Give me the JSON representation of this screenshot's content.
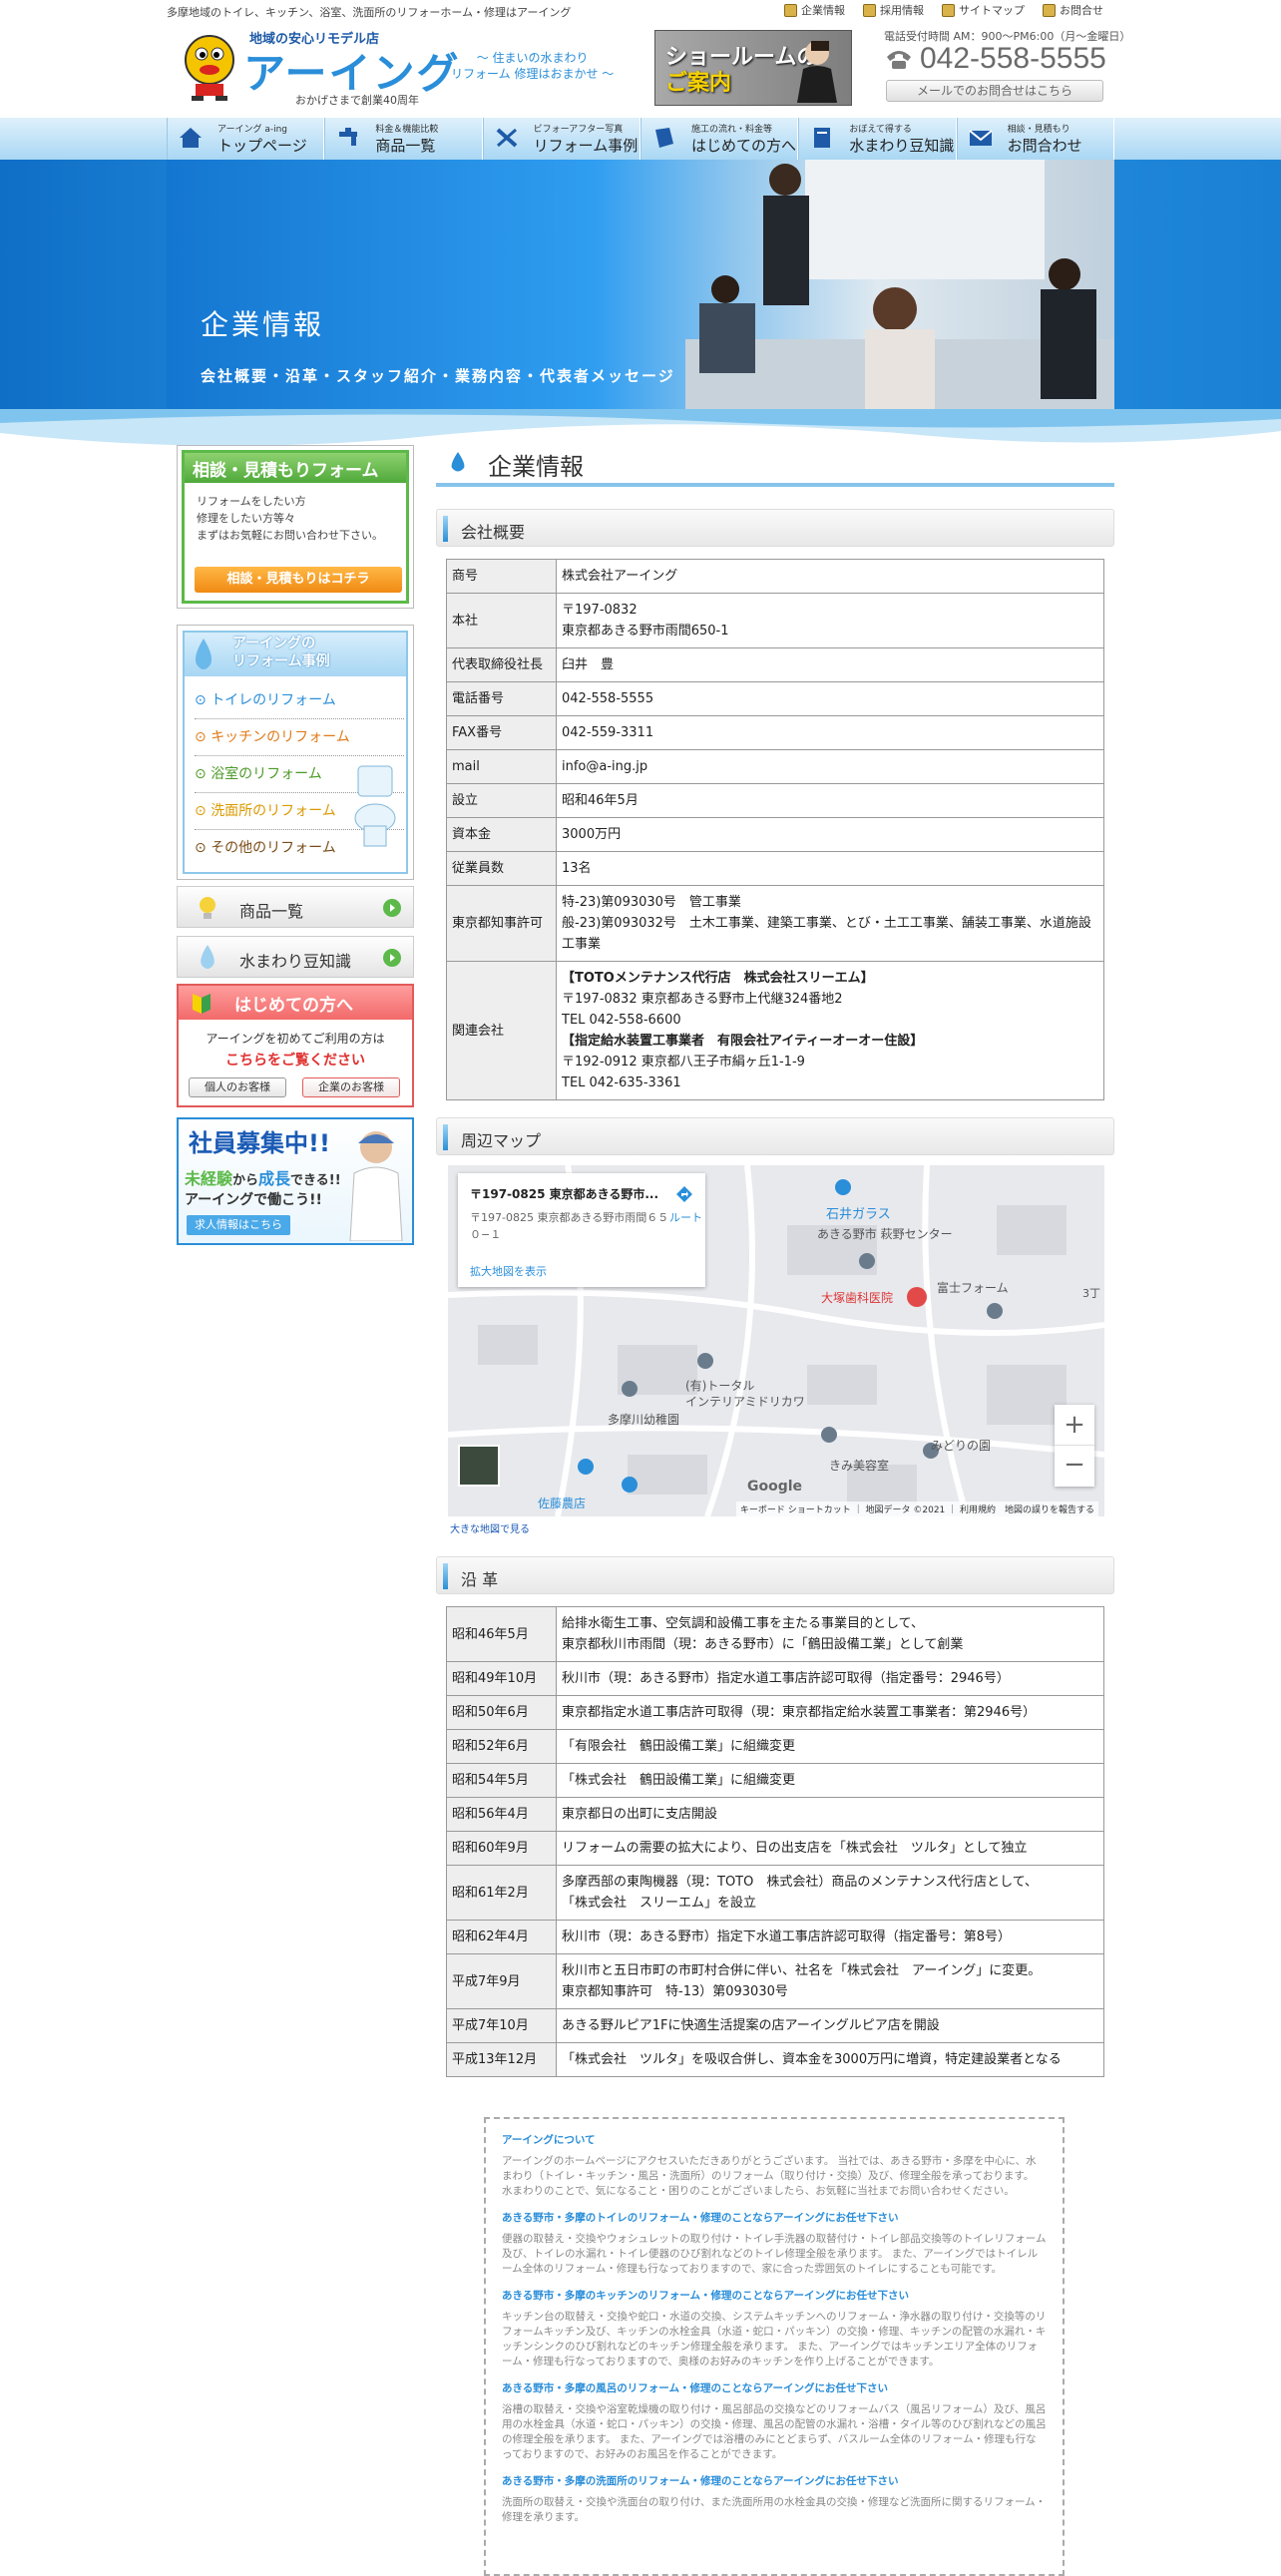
{
  "topbar": {
    "tagline": "多摩地域のトイレ、キッチン、浴室、洗面所のリフォーホーム・修理はアーイング",
    "links": [
      "企業情報",
      "採用情報",
      "サイトマップ",
      "お問合せ"
    ]
  },
  "header": {
    "logo_sub": "地域の安心リモデル店",
    "logo_main": "アーイング",
    "logo_since": "おかげさまで創業40周年",
    "catch_line1": "〜 住まいの水まわり",
    "catch_line2": "リフォーム 修理はおまかせ 〜",
    "showroom_line1": "ショールームの",
    "showroom_line2": "ご案内",
    "hours": "電話受付時間 AM：900〜PM6:00（月〜金曜日）",
    "phone": "042-558-5555",
    "mail_button": "メールでのお問合せはこちら"
  },
  "nav": [
    {
      "sub": "アーイング a-ing",
      "label": "トップページ"
    },
    {
      "sub": "料金＆機能比較",
      "label": "商品一覧"
    },
    {
      "sub": "ビフォーアフター写真",
      "label": "リフォーム事例"
    },
    {
      "sub": "施工の流れ・料金等",
      "label": "はじめての方へ"
    },
    {
      "sub": "おぼえて得する",
      "label": "水まわり豆知識"
    },
    {
      "sub": "相談・見積もり",
      "label": "お問合わせ"
    }
  ],
  "hero": {
    "title": "企業情報",
    "subtitle": "会社概要・沿革・スタッフ紹介・業務内容・代表者メッセージ"
  },
  "sidebar": {
    "consult": {
      "title": "相談・見積もりフォーム",
      "text1": "リフォームをしたい方",
      "text2": "修理をしたい方等々",
      "text3": "まずはお気軽にお問い合わせ下さい。",
      "button": "相談・見積もりはコチラ"
    },
    "cases": {
      "title1": "アーイングの",
      "title2": "リフォーム事例",
      "items": [
        "トイレのリフォーム",
        "キッチンのリフォーム",
        "浴室のリフォーム",
        "洗面所のリフォーム",
        "その他のリフォーム"
      ]
    },
    "products": "商品一覧",
    "water": "水まわり豆知識",
    "first": {
      "title": "はじめての方へ",
      "text": "アーイングを初めてご利用の方は",
      "link": "こちらをご覧ください",
      "btn_personal": "個人のお客様",
      "btn_company": "企業のお客様"
    },
    "recruit": {
      "title": "社員募集中!!",
      "line_a1": "未経験",
      "line_a2": "から",
      "line_a3": "成長",
      "line_a4": "できる!!",
      "line_b": "アーイングで働こう!!",
      "button": "求人情報はこちら"
    }
  },
  "content": {
    "page_title": "企業情報",
    "overview_title": "会社概要",
    "overview": [
      {
        "k": "商号",
        "v": [
          "株式会社アーイング"
        ]
      },
      {
        "k": "本社",
        "v": [
          "〒197-0832",
          "東京都あきる野市雨間650-1"
        ]
      },
      {
        "k": "代表取締役社長",
        "v": [
          "臼井　豊"
        ]
      },
      {
        "k": "電話番号",
        "v": [
          "042-558-5555"
        ]
      },
      {
        "k": "FAX番号",
        "v": [
          "042-559-3311"
        ]
      },
      {
        "k": "mail",
        "v": [
          "info@a-ing.jp"
        ]
      },
      {
        "k": "設立",
        "v": [
          "昭和46年5月"
        ]
      },
      {
        "k": "資本金",
        "v": [
          "3000万円"
        ]
      },
      {
        "k": "従業員数",
        "v": [
          "13名"
        ]
      },
      {
        "k": "東京都知事許可",
        "v": [
          "特-23)第093030号　管工事業",
          "般-23)第093032号　土木工事業、建築工事業、とび・土工工事業、舗装工事業、水道施設工事業"
        ]
      },
      {
        "k": "関連会社",
        "v": [
          "【TOTOメンテナンス代行店　株式会社スリーエム】",
          "〒197-0832 東京都あきる野市上代継324番地2",
          "TEL 042-558-6600",
          "【指定給水装置工事業者　有限会社アイティーオーオー住設】",
          "〒192-0912 東京都八王子市絹ヶ丘1-1-9",
          "TEL 042-635-3361"
        ]
      }
    ],
    "map_title": "周辺マップ",
    "map": {
      "card_title": "〒197-0825 東京都あきる野市...",
      "card_addr": "〒197-0825 東京都あきる野市雨間６５０−１",
      "route": "ルート",
      "enlarge": "拡大地図を表示",
      "labels": [
        "石井ガラス",
        "あきる野市 萩野センター",
        "大塚歯科医院",
        "富士フォーム",
        "(有)トータル",
        "インテリアミドリカワ",
        "多摩川幼稚園",
        "きみ美容室",
        "みどりの園",
        "佐藤農店",
        "3丁"
      ],
      "zoom_in": "+",
      "zoom_out": "−",
      "attribution": "キーボード ショートカット ｜ 地図データ ©2021 ｜ 利用規約　地図の誤りを報告する",
      "google": "Google",
      "bottom_link": "大きな地図で見る"
    },
    "history_title": "沿 革",
    "history": [
      {
        "k": "昭和46年5月",
        "v": [
          "給排水衛生工事、空気調和設備工事を主たる事業目的として、",
          "東京都秋川市雨間（現：あきる野市）に「鶴田設備工業」として創業"
        ]
      },
      {
        "k": "昭和49年10月",
        "v": [
          "秋川市（現：あきる野市）指定水道工事店許認可取得（指定番号：2946号）"
        ]
      },
      {
        "k": "昭和50年6月",
        "v": [
          "東京都指定水道工事店許可取得（現：東京都指定給水装置工事業者：第2946号）"
        ]
      },
      {
        "k": "昭和52年6月",
        "v": [
          "「有限会社　鶴田設備工業」に組織変更"
        ]
      },
      {
        "k": "昭和54年5月",
        "v": [
          "「株式会社　鶴田設備工業」に組織変更"
        ]
      },
      {
        "k": "昭和56年4月",
        "v": [
          "東京都日の出町に支店開設"
        ]
      },
      {
        "k": "昭和60年9月",
        "v": [
          "リフォームの需要の拡大により、日の出支店を「株式会社　ツルタ」として独立"
        ]
      },
      {
        "k": "昭和61年2月",
        "v": [
          "多摩西部の東陶機器（現：TOTO　株式会社）商品のメンテナンス代行店として、",
          "「株式会社　スリーエム」を設立"
        ]
      },
      {
        "k": "昭和62年4月",
        "v": [
          "秋川市（現：あきる野市）指定下水道工事店許認可取得（指定番号：第8号）"
        ]
      },
      {
        "k": "平成7年9月",
        "v": [
          "秋川市と五日市町の市町村合併に伴い、社名を「株式会社　アーイング」に変更。",
          "東京都知事許可　特-13）第093030号"
        ]
      },
      {
        "k": "平成7年10月",
        "v": [
          "あきる野ルピア1Fに快適生活提案の店アーイングルピア店を開設"
        ]
      },
      {
        "k": "平成13年12月",
        "v": [
          "「株式会社　ツルタ」を吸収合併し、資本金を3000万円に増資，特定建設業者となる"
        ]
      }
    ]
  },
  "seo": [
    {
      "title": "アーイングについて",
      "text": "アーイングのホームページにアクセスいただきありがとうございます。 当社では、あきる野市・多摩を中心に、水まわり（トイレ・キッチン・風呂・洗面所）のリフォーム（取り付け・交換）及び、修理全般を承っております。 水まわりのことで、気になること・困りのことがございましたら、お気軽に当社までお問い合わせください。"
    },
    {
      "title": "あきる野市・多摩のトイレのリフォーム・修理のことならアーイングにお任せ下さい",
      "text": "便器の取替え・交換やウォシュレットの取り付け・トイレ手洗器の取替付け・トイレ部品交換等のトイレリフォーム及び、トイレの水漏れ・トイレ便器のひび割れなどのトイレ修理全般を承ります。 また、アーイングではトイレルーム全体のリフォーム・修理も行なっておりますので、家に合った雰囲気のトイレにすることも可能です。"
    },
    {
      "title": "あきる野市・多摩のキッチンのリフォーム・修理のことならアーイングにお任せ下さい",
      "text": "キッチン台の取替え・交換や蛇口・水道の交換、システムキッチンへのリフォーム・浄水器の取り付け・交換等のリフォームキッチン及び、キッチンの水栓金具（水道・蛇口・パッキン）の交換・修理、キッチンの配管の水漏れ・キッチンシンクのひび割れなどのキッチン修理全般を承ります。 また、アーイングではキッチンエリア全体のリフォーム・修理も行なっておりますので、奥様のお好みのキッチンを作り上げることができます。"
    },
    {
      "title": "あきる野市・多摩の風呂のリフォーム・修理のことならアーイングにお任せ下さい",
      "text": "浴槽の取替え・交換や浴室乾燥機の取り付け・風呂部品の交換などのリフォームバス（風呂リフォーム）及び、風呂用の水栓金具（水道・蛇口・パッキン）の交換・修理、風呂の配管の水漏れ・浴槽・タイル等のひび割れなどの風呂の修理全般を承ります。 また、アーイングでは浴槽のみにとどまらず、バスルーム全体のリフォーム・修理も行なっておりますので、お好みのお風呂を作ることができます。"
    },
    {
      "title": "あきる野市・多摩の洗面所のリフォーム・修理のことならアーイングにお任せ下さい",
      "text": "洗面所の取替え・交換や洗面台の取り付け、また洗面所用の水栓金具の交換・修理など洗面所に関するリフォーム・修理を承ります。"
    }
  ]
}
